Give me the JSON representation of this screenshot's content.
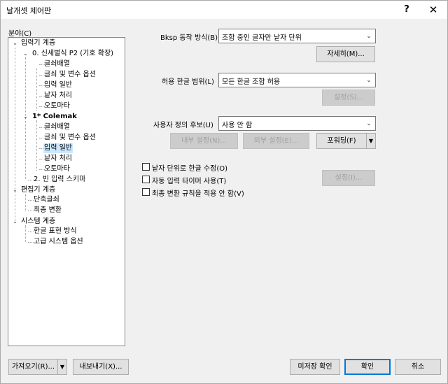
{
  "window": {
    "title": "날개셋 제어판",
    "help": "?",
    "close": "✕"
  },
  "tree": {
    "label": "분야(C)",
    "items": [
      {
        "label": "입력기 계층"
      },
      {
        "label": "0. 신세벌식 P2 (기호 확장)"
      },
      {
        "label": "글쇠배열"
      },
      {
        "label": "글쇠 및 변수 옵션"
      },
      {
        "label": "입력 일반"
      },
      {
        "label": "낱자 처리"
      },
      {
        "label": "오토마타"
      },
      {
        "label": "1* Colemak"
      },
      {
        "label": "글쇠배열"
      },
      {
        "label": "글쇠 및 변수 옵션"
      },
      {
        "label": "입력 일반"
      },
      {
        "label": "낱자 처리"
      },
      {
        "label": "오토마타"
      },
      {
        "label": "2. 빈 입력 스키마"
      },
      {
        "label": "편집기 계층"
      },
      {
        "label": "단축글쇠"
      },
      {
        "label": "최종 변환"
      },
      {
        "label": "시스템 계층"
      },
      {
        "label": "한글 표현 방식"
      },
      {
        "label": "고급 시스템 옵션"
      }
    ]
  },
  "settings": {
    "bksp_label": "Bksp 동작 방식(B)",
    "bksp_value": "조합 중인 글자만 낱자 단위",
    "detail_button": "자세히(M)...",
    "range_label": "허용 한글 범위(L)",
    "range_value": "모든 한글 조합 허용",
    "range_settings_button": "설정(S)...",
    "candidate_label": "사용자 정의 후보(U)",
    "candidate_value": "사용 안 함",
    "internal_settings_button": "내부 설정(N)...",
    "external_settings_button": "외부 설정(E)...",
    "forwarding_button": "포워딩(F)",
    "forwarding_arrow": "▼",
    "checks": [
      {
        "label": "낱자 단위로 한글 수정(O)",
        "checked": false
      },
      {
        "label": "자동 입력 타이머 사용(T)",
        "checked": false
      },
      {
        "label": "최종 변환 규칙을 적용 안 함(V)",
        "checked": false
      }
    ],
    "timer_settings_button": "설정(I)..."
  },
  "footer": {
    "import_button": "가져오기(R)...",
    "import_arrow": "▼",
    "export_button": "내보내기(X)...",
    "unsaved_button": "미저장 확인",
    "ok_button": "확인",
    "cancel_button": "취소"
  }
}
